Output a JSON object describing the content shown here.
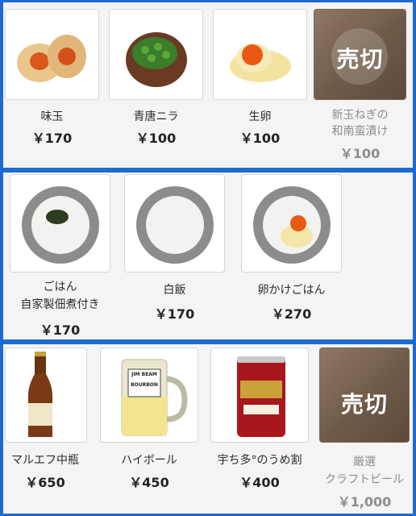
{
  "sections": [
    {
      "items": [
        {
          "name": "味玉",
          "price": "￥170",
          "icon": "marinated-egg"
        },
        {
          "name": "青唐ニラ",
          "price": "￥100",
          "icon": "green-chili-chive"
        },
        {
          "name": "生卵",
          "price": "￥100",
          "icon": "raw-egg"
        },
        {
          "name_line1": "新玉ねぎの",
          "name_line2": "和南蛮漬け",
          "price": "￥100",
          "icon": "sold-out",
          "status": "売切"
        }
      ]
    },
    {
      "items": [
        {
          "name_line1": "ごはん",
          "name_line2": "自家製佃煮付き",
          "price": "￥170",
          "icon": "rice-with-tsukudani"
        },
        {
          "name": "白飯",
          "price": "￥170",
          "icon": "white-rice"
        },
        {
          "name": "卵かけごはん",
          "price": "￥270",
          "icon": "egg-rice"
        }
      ]
    },
    {
      "items": [
        {
          "name": "マルエフ中瓶",
          "price": "￥650",
          "icon": "beer-bottle"
        },
        {
          "name": "ハイボール",
          "price": "￥450",
          "icon": "highball-mug",
          "brand_text": "JIM BEAM",
          "brand_sub": "BOURBON"
        },
        {
          "name": "宇ち多°のうめ割",
          "price": "￥400",
          "icon": "ume-chuhai-can"
        },
        {
          "name_line1": "厳選",
          "name_line2": "クラフトビール",
          "price": "￥1,000",
          "icon": "sold-out",
          "status": "売切"
        }
      ]
    }
  ],
  "colors": {
    "frame": "#1f6ad0",
    "panel": "#f4f4f4",
    "soldout": "#7a6553"
  }
}
